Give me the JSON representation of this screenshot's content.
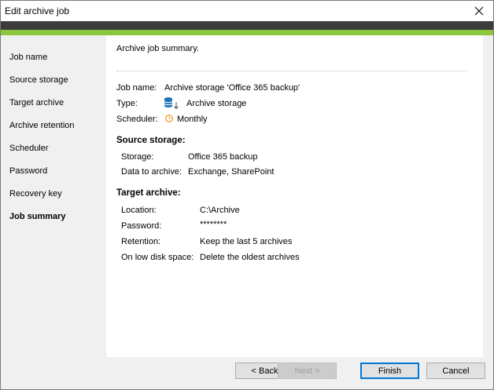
{
  "window": {
    "title": "Edit archive job"
  },
  "sidebar": {
    "items": [
      {
        "label": "Job name",
        "active": false
      },
      {
        "label": "Source storage",
        "active": false
      },
      {
        "label": "Target archive",
        "active": false
      },
      {
        "label": "Archive retention",
        "active": false
      },
      {
        "label": "Scheduler",
        "active": false
      },
      {
        "label": "Password",
        "active": false
      },
      {
        "label": "Recovery key",
        "active": false
      },
      {
        "label": "Job summary",
        "active": true
      }
    ]
  },
  "summary": {
    "heading": "Archive job summary.",
    "job_name": {
      "label": "Job name:",
      "value": "Archive storage 'Office 365 backup'"
    },
    "type": {
      "label": "Type:",
      "value": "Archive storage",
      "icon": "archive-storage-icon"
    },
    "scheduler": {
      "label": "Scheduler:",
      "value": "Monthly",
      "icon": "clock-icon"
    },
    "source_storage": {
      "title": "Source storage:",
      "storage_label": "Storage:",
      "storage_value": "Office 365 backup",
      "data_label": "Data to archive:",
      "data_value": "Exchange, SharePoint"
    },
    "target_archive": {
      "title": "Target archive:",
      "location_label": "Location:",
      "location_value": "C:\\Archive",
      "password_label": "Password:",
      "password_value": "********",
      "retention_label": "Retention:",
      "retention_value": "Keep the last 5 archives",
      "low_disk_label": "On low disk space:",
      "low_disk_value": "Delete the oldest archives"
    }
  },
  "buttons": {
    "back": "< Back",
    "next": "Next >",
    "finish": "Finish",
    "cancel": "Cancel"
  },
  "colors": {
    "accent_green": "#8cc63f",
    "header_dark": "#3c3c3c",
    "icon_blue": "#1e73be",
    "clock_orange": "#f0a030",
    "default_button_border": "#0078d7"
  }
}
